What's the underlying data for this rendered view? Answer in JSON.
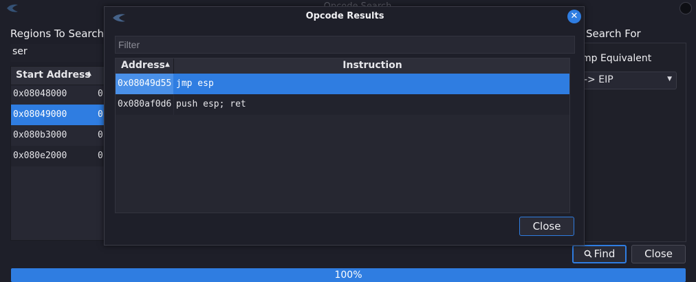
{
  "main_window": {
    "title": "Opcode Search",
    "regions_label": "Regions To Search:",
    "regions_filter_value": "ser",
    "regions_table": {
      "header": "Start Address",
      "rows": [
        {
          "start": "0x08048000",
          "col2": "0"
        },
        {
          "start": "0x08049000",
          "col2": "0"
        },
        {
          "start": "0x080b3000",
          "col2": "0"
        },
        {
          "start": "0x080e2000",
          "col2": "0"
        }
      ],
      "selected_row": 1
    },
    "search_for_label": "o Search For",
    "radio_label": "mp Equivalent",
    "combo_value": "-> EIP",
    "find_label": "Find",
    "close_label": "Close",
    "progress_text": "100%",
    "progress_value": 1.0
  },
  "dialog": {
    "title": "Opcode Results",
    "filter_placeholder": "Filter",
    "filter_value": "",
    "columns": {
      "address": "Address",
      "instruction": "Instruction"
    },
    "rows": [
      {
        "address": "0x08049d55",
        "instruction": "jmp esp"
      },
      {
        "address": "0x080af0d6",
        "instruction": "push esp; ret"
      }
    ],
    "selected_row": 0,
    "close_label": "Close"
  },
  "icons": {
    "app": "dragon-logo-icon",
    "dialog_close": "close-icon",
    "find": "search-icon",
    "sort": "sort-ascending-icon",
    "dropdown": "chevron-down-icon"
  },
  "colors": {
    "accent": "#2f7de1",
    "background": "#1e1f29"
  }
}
